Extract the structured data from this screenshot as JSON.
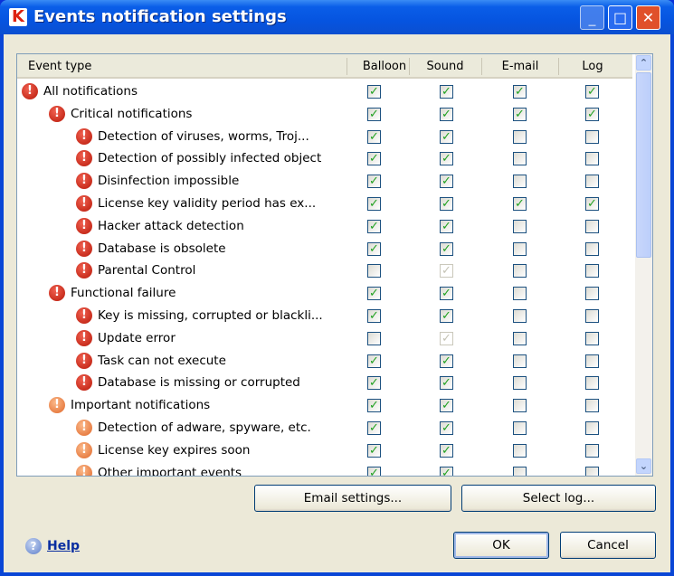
{
  "window": {
    "title": "Events notification settings",
    "icon_letter": "K"
  },
  "table": {
    "columns": [
      "Event type",
      "Balloon",
      "Sound",
      "E-mail",
      "Log"
    ],
    "rows": [
      {
        "label": "All notifications",
        "level": 0,
        "severity": "critical",
        "balloon": "on",
        "sound": "on",
        "email": "on",
        "log": "on"
      },
      {
        "label": "Critical notifications",
        "level": 1,
        "severity": "critical",
        "balloon": "on",
        "sound": "on",
        "email": "on",
        "log": "on"
      },
      {
        "label": "Detection of viruses, worms, Troj...",
        "level": 2,
        "severity": "critical",
        "balloon": "on",
        "sound": "on",
        "email": "off",
        "log": "off"
      },
      {
        "label": "Detection of possibly infected object",
        "level": 2,
        "severity": "critical",
        "balloon": "on",
        "sound": "on",
        "email": "off",
        "log": "off"
      },
      {
        "label": "Disinfection impossible",
        "level": 2,
        "severity": "critical",
        "balloon": "on",
        "sound": "on",
        "email": "off",
        "log": "off"
      },
      {
        "label": "License key validity period has ex...",
        "level": 2,
        "severity": "critical",
        "balloon": "on",
        "sound": "on",
        "email": "on",
        "log": "on"
      },
      {
        "label": "Hacker attack detection",
        "level": 2,
        "severity": "critical",
        "balloon": "on",
        "sound": "on",
        "email": "off",
        "log": "off"
      },
      {
        "label": "Database is obsolete",
        "level": 2,
        "severity": "critical",
        "balloon": "on",
        "sound": "on",
        "email": "off",
        "log": "off"
      },
      {
        "label": "Parental Control",
        "level": 2,
        "severity": "critical",
        "balloon": "off",
        "sound": "disabled",
        "email": "off",
        "log": "off"
      },
      {
        "label": "Functional failure",
        "level": 1,
        "severity": "critical",
        "balloon": "on",
        "sound": "on",
        "email": "off",
        "log": "off"
      },
      {
        "label": "Key is missing, corrupted or blackli...",
        "level": 2,
        "severity": "critical",
        "balloon": "on",
        "sound": "on",
        "email": "off",
        "log": "off"
      },
      {
        "label": "Update error",
        "level": 2,
        "severity": "critical",
        "balloon": "off",
        "sound": "disabled",
        "email": "off",
        "log": "off"
      },
      {
        "label": "Task can not execute",
        "level": 2,
        "severity": "critical",
        "balloon": "on",
        "sound": "on",
        "email": "off",
        "log": "off"
      },
      {
        "label": "Database is missing or corrupted",
        "level": 2,
        "severity": "critical",
        "balloon": "on",
        "sound": "on",
        "email": "off",
        "log": "off"
      },
      {
        "label": "Important notifications",
        "level": 1,
        "severity": "important",
        "balloon": "on",
        "sound": "on",
        "email": "off",
        "log": "off"
      },
      {
        "label": "Detection of adware, spyware, etc.",
        "level": 2,
        "severity": "important",
        "balloon": "on",
        "sound": "on",
        "email": "off",
        "log": "off"
      },
      {
        "label": "License key expires soon",
        "level": 2,
        "severity": "important",
        "balloon": "on",
        "sound": "on",
        "email": "off",
        "log": "off"
      },
      {
        "label": "Other important events",
        "level": 2,
        "severity": "important",
        "balloon": "on",
        "sound": "on",
        "email": "off",
        "log": "off"
      }
    ]
  },
  "buttons": {
    "email_settings": "Email settings...",
    "select_log": "Select log...",
    "ok": "OK",
    "cancel": "Cancel",
    "help": "Help"
  }
}
